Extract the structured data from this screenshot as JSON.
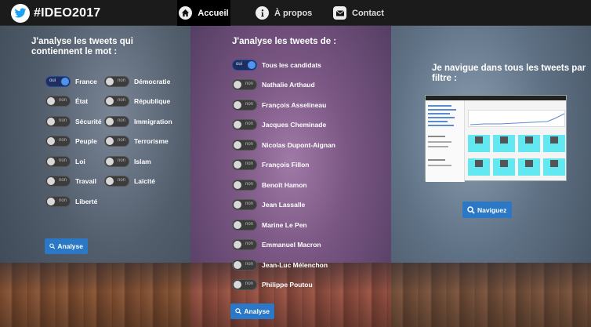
{
  "nav": {
    "brand": "#IDEO2017",
    "items": [
      {
        "label": "Accueil",
        "icon": "home-icon",
        "active": true
      },
      {
        "label": "À propos",
        "icon": "info-icon",
        "active": false
      },
      {
        "label": "Contact",
        "icon": "mail-icon",
        "active": false
      }
    ]
  },
  "left": {
    "title_line1": "J'analyse les tweets qui",
    "title_line2": "contiennent le mot :",
    "col1": [
      {
        "label": "France",
        "state": "oui"
      },
      {
        "label": "État",
        "state": "non"
      },
      {
        "label": "Sécurité",
        "state": "non"
      },
      {
        "label": "Peuple",
        "state": "non"
      },
      {
        "label": "Loi",
        "state": "non"
      },
      {
        "label": "Travail",
        "state": "non"
      },
      {
        "label": "Liberté",
        "state": "non"
      }
    ],
    "col2": [
      {
        "label": "Démocratie",
        "state": "non"
      },
      {
        "label": "République",
        "state": "non"
      },
      {
        "label": "Immigration",
        "state": "non"
      },
      {
        "label": "Terrorisme",
        "state": "non"
      },
      {
        "label": "Islam",
        "state": "non"
      },
      {
        "label": "Laïcité",
        "state": "non"
      }
    ],
    "button": "Analyse"
  },
  "middle": {
    "title": "J'analyse les tweets de :",
    "candidates": [
      {
        "label": "Tous les candidats",
        "state": "oui"
      },
      {
        "label": "Nathalie Arthaud",
        "state": "non"
      },
      {
        "label": "François Asselineau",
        "state": "non"
      },
      {
        "label": "Jacques Cheminade",
        "state": "non"
      },
      {
        "label": "Nicolas Dupont-Aignan",
        "state": "non"
      },
      {
        "label": "François Fillon",
        "state": "non"
      },
      {
        "label": "Benoît Hamon",
        "state": "non"
      },
      {
        "label": "Jean Lassalle",
        "state": "non"
      },
      {
        "label": "Marine Le Pen",
        "state": "non"
      },
      {
        "label": "Emmanuel Macron",
        "state": "non"
      },
      {
        "label": "Jean-Luc Mélenchon",
        "state": "non"
      },
      {
        "label": "Philippe Poutou",
        "state": "non"
      }
    ],
    "button": "Analyse"
  },
  "right": {
    "title_line1": "Je navigue dans tous les tweets par",
    "title_line2": "filtre :",
    "button": "Naviguez"
  },
  "colors": {
    "accent": "#2a78c6",
    "toggle_on": "#4f95f0",
    "thumb_card": "#62e8f1"
  }
}
